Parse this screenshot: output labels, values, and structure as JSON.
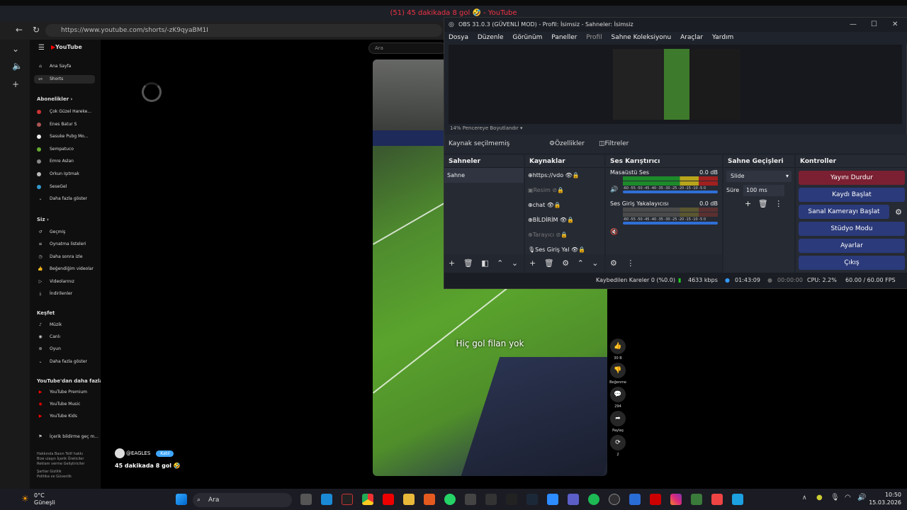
{
  "browser": {
    "tab_title": "(51) 45 dakikada 8 gol 🤣 - YouTube",
    "url": "https://www.youtube.com/shorts/-zK9qyaBM1I"
  },
  "youtube": {
    "logo": "YouTube",
    "search_placeholder": "Ara",
    "nav": [
      {
        "label": "Ana Sayfa",
        "icon": "home-icon"
      },
      {
        "label": "Shorts",
        "icon": "shorts-icon"
      }
    ],
    "subscriptions_header": "Abonelikler",
    "subscriptions": [
      "Çok Güzel Hareke...",
      "Enes Batur S",
      "Sasuke Pubg Mo...",
      "Sempatuco",
      "Emre Aslan",
      "Orkun Işıtmak",
      "SeseGel",
      "Daha fazla göster"
    ],
    "you_header": "Siz",
    "you_items": [
      "Geçmiş",
      "Oynatma listeleri",
      "Daha sonra izle",
      "Beğendiğim videolar",
      "Videolarınız",
      "İndirilenler"
    ],
    "explore_header": "Keşfet",
    "explore_items": [
      "Müzik",
      "Canlı",
      "Oyun",
      "Daha fazla göster"
    ],
    "more_header": "YouTube'dan daha fazla...",
    "more_items": [
      "YouTube Premium",
      "YouTube Music",
      "YouTube Kids"
    ],
    "report_item": "İçerik bildirme geç m...",
    "footer": [
      "Hakkında  Basın  Telif hakkı",
      "Bize ulaşın  İçerik Üreticiler",
      "Reklam verme  Geliştiriciler",
      "Şartlar  Gizlilik",
      "Politika ve Güvenlik"
    ],
    "short": {
      "caption": "Hiç gol filan yok",
      "channel": "@EAGLES",
      "subscribe": "Katıl",
      "title": "45 dakikada 8 gol 🤣",
      "likes": "30 B",
      "dislike": "Beğenme",
      "comments": "294",
      "share": "Paylaş",
      "remix": "2"
    }
  },
  "obs": {
    "title": "OBS 31.0.3 (GÜVENLİ MOD) - Profil: İsimsiz - Sahneler: İsimsiz",
    "menu": [
      "Dosya",
      "Düzenle",
      "Görünüm",
      "Paneller",
      "Profil",
      "Sahne Koleksiyonu",
      "Araçlar",
      "Yardım"
    ],
    "zoom_label": "14%   Pencereye Boyutlandır",
    "no_source": "Kaynak seçilmemiş",
    "properties": "Özellikler",
    "filters": "Filtreler",
    "scenes_header": "Sahneler",
    "scenes": [
      "Sahne"
    ],
    "sources_header": "Kaynaklar",
    "sources": [
      {
        "label": "https://vdo",
        "hidden": false
      },
      {
        "label": "Resim",
        "hidden": true
      },
      {
        "label": "chat",
        "hidden": false
      },
      {
        "label": "BİLDİRİM",
        "hidden": false
      },
      {
        "label": "Tarayıcı",
        "hidden": true
      },
      {
        "label": "Ses Giriş Yal",
        "hidden": false
      }
    ],
    "mixer_header": "Ses Karıştırıcı",
    "mixer": [
      {
        "name": "Masaüstü Ses",
        "db": "0.0 dB"
      },
      {
        "name": "Ses Giriş Yakalayıcısı",
        "db": "0.0 dB"
      }
    ],
    "meter_ticks": "-60 -55 -50 -45 -40 -35 -30 -25 -20 -15 -10 -5  0",
    "transitions_header": "Sahne Geçişleri",
    "transition": "Slide",
    "duration_label": "Süre",
    "duration": "100 ms",
    "controls_header": "Kontroller",
    "controls": {
      "stop_stream": "Yayını Durdur",
      "start_record": "Kaydı Başlat",
      "virtual_cam": "Sanal Kamerayı Başlat",
      "studio": "Stüdyo Modu",
      "settings": "Ayarlar",
      "exit": "Çıkış"
    },
    "status": {
      "dropped": "Kaybedilen Kareler 0 (%0.0)",
      "bitrate": "4633 kbps",
      "stream_time": "01:43:09",
      "rec_time": "00:00:00",
      "cpu": "CPU: 2.2%",
      "fps": "60.00 / 60.00 FPS"
    }
  },
  "taskbar": {
    "weather_temp": "0°C",
    "weather_desc": "Güneşli",
    "search": "Ara",
    "time": "10:50",
    "date": "15.03.2026"
  }
}
